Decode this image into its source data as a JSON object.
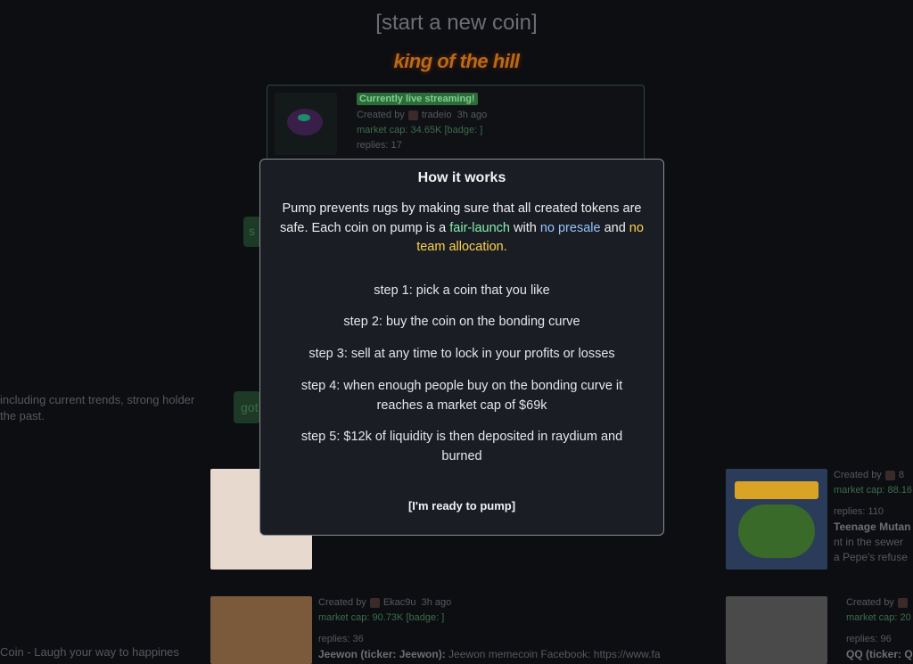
{
  "header": {
    "start_link": "[start a new coin]",
    "koth_title": "king of the hill"
  },
  "king": {
    "live_badge": "Currently live streaming!",
    "created_by": "Created by",
    "creator": "tradeio",
    "age": "3h ago",
    "market_cap": "market cap: 34.65K",
    "badge": "[badge: ]",
    "replies": "replies: 17"
  },
  "left_side": {
    "button_1": "s",
    "text_1a": "including current trends, strong holder",
    "text_1b": "the past.",
    "button_2": "got",
    "text_2": "Coin - Laugh your way to happines"
  },
  "cards": {
    "right_top": {
      "created_by": "Created by",
      "creator_partial": "8",
      "market_cap": "market cap: 88.16",
      "replies": "replies: 110",
      "title": "Teenage Mutan",
      "desc1": "nt in the sewer",
      "desc2": "a Pepe's refuse"
    },
    "mid_bottom": {
      "created_by": "Created by",
      "creator": "Ekac9u",
      "age": "3h ago",
      "market_cap": "market cap: 90.73K",
      "badge": "[badge: ]",
      "replies": "replies: 36",
      "title": "Jeewon (ticker: Jeewon):",
      "desc": " Jeewon memecoin Facebook: https://www.fa"
    },
    "right_bottom": {
      "created_by": "Created by",
      "market_cap": "market cap: 20",
      "replies": "replies: 96",
      "title": "QQ (ticker: Q"
    }
  },
  "modal": {
    "title": "How it works",
    "intro_a": "Pump prevents rugs by making sure that all created tokens are safe. Each coin on pump is a ",
    "intro_fair": "fair-launch",
    "intro_with": " with ",
    "intro_presale": "no presale",
    "intro_and": " and ",
    "intro_team": "no team allocation.",
    "steps": [
      "step 1: pick a coin that you like",
      "step 2: buy the coin on the bonding curve",
      "step 3: sell at any time to lock in your profits or losses",
      "step 4: when enough people buy on the bonding curve it reaches a market cap of $69k",
      "step 5: $12k of liquidity is then deposited in raydium and burned"
    ],
    "ready_button": "[I'm ready to pump]"
  },
  "colors": {
    "fair_launch": "#86efac",
    "no_presale": "#93c5fd",
    "no_team": "#fcd34d"
  }
}
